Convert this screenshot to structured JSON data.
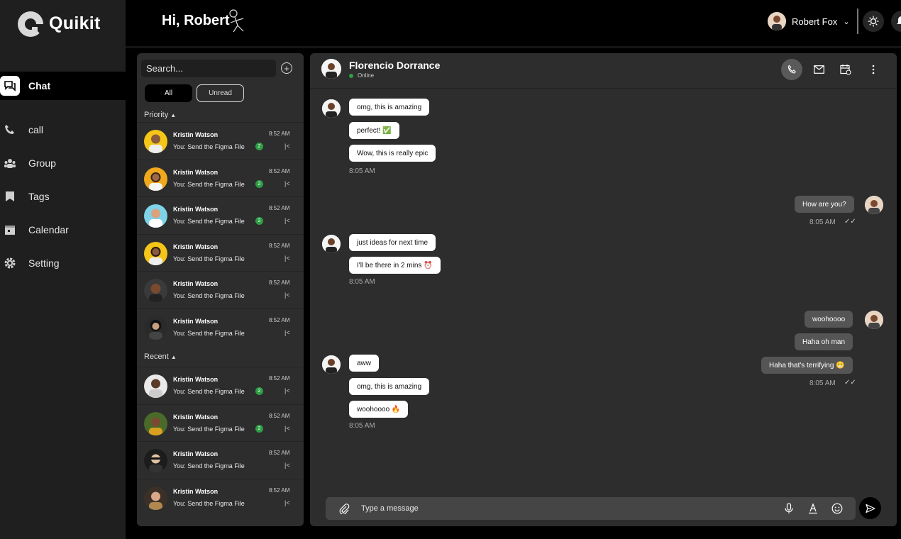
{
  "brand": {
    "name": "Quikit"
  },
  "header": {
    "greeting": "Hi, Robert",
    "user_name": "Robert Fox"
  },
  "sidebar": {
    "items": [
      {
        "label": "Chat",
        "icon": "chat-icon",
        "active": true
      },
      {
        "label": "call",
        "icon": "phone-icon"
      },
      {
        "label": "Group",
        "icon": "group-icon"
      },
      {
        "label": "Tags",
        "icon": "tag-icon"
      },
      {
        "label": "Calendar",
        "icon": "calendar-icon"
      },
      {
        "label": "Setting",
        "icon": "gear-icon"
      }
    ]
  },
  "list": {
    "search_placeholder": "Search...",
    "filters": {
      "all": "All",
      "unread": "Unread"
    },
    "priority_label": "Priority",
    "recent_label": "Recent",
    "priority": [
      {
        "name": "Kristin Watson",
        "message": "You: Send the Figma File",
        "time": "8:52 AM",
        "badge": "2"
      },
      {
        "name": "Kristin Watson",
        "message": "You: Send the Figma File",
        "time": "8:52 AM",
        "badge": "2"
      },
      {
        "name": "Kristin Watson",
        "message": "You: Send the Figma File",
        "time": "8:52 AM",
        "badge": "2"
      },
      {
        "name": "Kristin Watson",
        "message": "You: Send the Figma File",
        "time": "8:52 AM",
        "badge": ""
      },
      {
        "name": "Kristin Watson",
        "message": "You: Send the Figma File",
        "time": "8:52 AM",
        "badge": ""
      },
      {
        "name": "Kristin Watson",
        "message": "You: Send the Figma File",
        "time": "8:52 AM",
        "badge": ""
      }
    ],
    "recent": [
      {
        "name": "Kristin Watson",
        "message": "You: Send the Figma File",
        "time": "8:52 AM",
        "badge": "2"
      },
      {
        "name": "Kristin Watson",
        "message": "You: Send the Figma File",
        "time": "8:52 AM",
        "badge": "2"
      },
      {
        "name": "Kristin Watson",
        "message": "You: Send the Figma File",
        "time": "8:52 AM",
        "badge": ""
      },
      {
        "name": "Kristin Watson",
        "message": "You: Send the Figma File",
        "time": "8:52 AM",
        "badge": ""
      }
    ]
  },
  "chat": {
    "contact_name": "Florencio Dorrance",
    "status": "Online",
    "messages": [
      {
        "text": "omg, this is amazing"
      },
      {
        "text": "perfect! ✅"
      },
      {
        "text": "Wow, this is really epic"
      },
      {
        "text": "8:05 AM"
      },
      {
        "text": "How are you?"
      },
      {
        "text": "8:05 AM"
      },
      {
        "text": "just ideas for next time"
      },
      {
        "text": "I'll be there in 2 mins ⏰"
      },
      {
        "text": "8:05 AM"
      },
      {
        "text": "woohoooo"
      },
      {
        "text": "Haha oh man"
      },
      {
        "text": "Haha that's terrifying 😬"
      },
      {
        "text": "8:05 AM"
      },
      {
        "text": "aww"
      },
      {
        "text": "omg, this is amazing"
      },
      {
        "text": "woohoooo 🔥"
      },
      {
        "text": "8:05 AM"
      }
    ],
    "composer_placeholder": "Type a message"
  }
}
